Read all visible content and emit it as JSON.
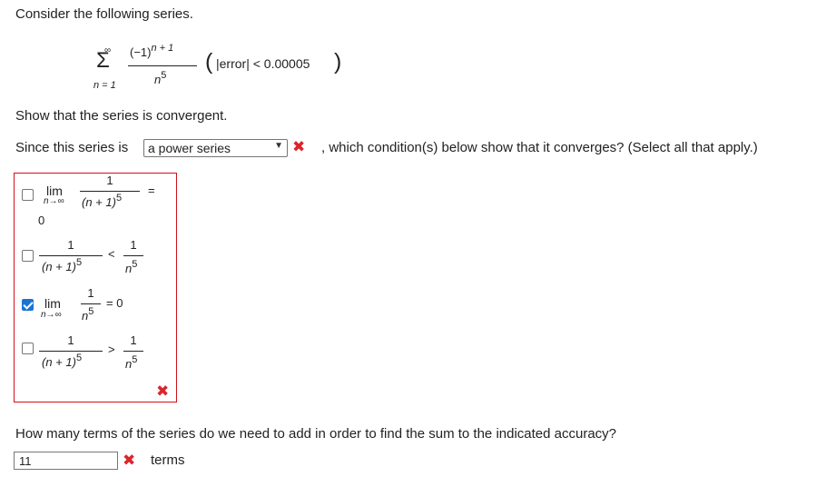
{
  "question": {
    "intro": "Consider the following series.",
    "series": {
      "sigma": "Σ",
      "upper": "∞",
      "lower": "n = 1",
      "numerator_base": "(−1)",
      "numerator_exp": "n + 1",
      "denominator_base": "n",
      "denominator_exp": "5",
      "error_open": "(",
      "error_text": "|error| < 0.00005",
      "error_close": ")"
    },
    "part1": "Show that the series is convergent.",
    "since_prefix": "Since this series is",
    "since_suffix": ", which condition(s) below show that it converges? (Select all that apply.)"
  },
  "series_type_select": {
    "selected": "a power series",
    "status": "incorrect"
  },
  "options": [
    {
      "checked": false,
      "lim": "lim",
      "lim_sub": "n→∞",
      "num": "1",
      "den_base": "(n + 1)",
      "den_exp": "5",
      "relation": "=",
      "rhs": "0"
    },
    {
      "checked": false,
      "left_num": "1",
      "left_den_base": "(n + 1)",
      "left_den_exp": "5",
      "relation": "<",
      "right_num": "1",
      "right_den_base": "n",
      "right_den_exp": "5"
    },
    {
      "checked": true,
      "lim": "lim",
      "lim_sub": "n→∞",
      "num": "1",
      "den_base": "n",
      "den_exp": "5",
      "relation": "= 0"
    },
    {
      "checked": false,
      "left_num": "1",
      "left_den_base": "(n + 1)",
      "left_den_exp": "5",
      "relation": ">",
      "right_num": "1",
      "right_den_base": "n",
      "right_den_exp": "5"
    }
  ],
  "options_status": "incorrect",
  "part2": {
    "question": "How many terms of the series do we need to add in order to find the sum to the indicated accuracy?",
    "answer_value": "11",
    "status": "incorrect",
    "unit": "terms"
  },
  "icons": {
    "incorrect": "✖",
    "caret": "▼"
  },
  "colors": {
    "incorrect": "#d9262b",
    "panel_border": "#d0101b",
    "checkbox_checked": "#1b75d0"
  }
}
